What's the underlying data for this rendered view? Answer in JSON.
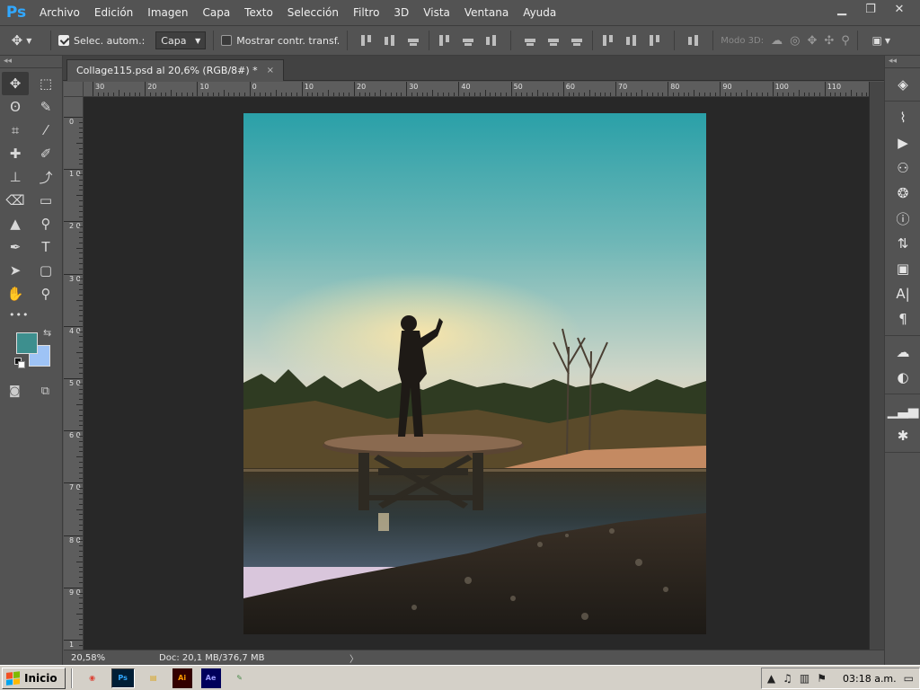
{
  "app": {
    "logo": "Ps",
    "menu": [
      "Archivo",
      "Edición",
      "Imagen",
      "Capa",
      "Texto",
      "Selección",
      "Filtro",
      "3D",
      "Vista",
      "Ventana",
      "Ayuda"
    ],
    "window_controls": {
      "minimize": "minimize-icon",
      "restore": "restore-icon",
      "close": "close-icon"
    }
  },
  "options_bar": {
    "auto_select_label": "Selec. autom.:",
    "auto_select_checked": true,
    "auto_select_target": "Capa",
    "show_transform_label": "Mostrar contr. transf.",
    "show_transform_checked": false,
    "mode_3d_label": "Modo 3D:"
  },
  "document": {
    "tab_title": "Collage115.psd al 20,6% (RGB/8#) *",
    "close_glyph": "×"
  },
  "rulers": {
    "horizontal": [
      "30",
      "20",
      "10",
      "0",
      "10",
      "20",
      "30",
      "40",
      "50",
      "60",
      "70",
      "80",
      "90",
      "100",
      "110"
    ],
    "vertical": [
      "0",
      "1 0",
      "2 0",
      "3 0",
      "4 0",
      "5 0",
      "6 0",
      "7 0",
      "8 0",
      "9 0",
      "1"
    ]
  },
  "toolbar": {
    "collapse": "◂◂",
    "tools": [
      {
        "name": "move-tool",
        "glyph": "✥",
        "active": true
      },
      {
        "name": "marquee-tool",
        "glyph": "⬚"
      },
      {
        "name": "lasso-tool",
        "glyph": "ʘ"
      },
      {
        "name": "quick-selection-tool",
        "glyph": "✎"
      },
      {
        "name": "crop-tool",
        "glyph": "⌗"
      },
      {
        "name": "eyedropper-tool",
        "glyph": "⁄"
      },
      {
        "name": "healing-brush-tool",
        "glyph": "✚"
      },
      {
        "name": "brush-tool",
        "glyph": "✐"
      },
      {
        "name": "clone-stamp-tool",
        "glyph": "⊥"
      },
      {
        "name": "history-brush-tool",
        "glyph": "⤴"
      },
      {
        "name": "eraser-tool",
        "glyph": "⌫"
      },
      {
        "name": "gradient-tool",
        "glyph": "▭"
      },
      {
        "name": "blur-tool",
        "glyph": "▲"
      },
      {
        "name": "dodge-tool",
        "glyph": "⚲"
      },
      {
        "name": "pen-tool",
        "glyph": "✒"
      },
      {
        "name": "type-tool",
        "glyph": "T"
      },
      {
        "name": "path-selection-tool",
        "glyph": "➤"
      },
      {
        "name": "shape-tool",
        "glyph": "▢"
      },
      {
        "name": "hand-tool",
        "glyph": "✋"
      },
      {
        "name": "zoom-tool",
        "glyph": "⚲"
      }
    ],
    "more_glyph": "•••",
    "foreground_color": "#3d8f8e",
    "background_color": "#9ec3f5",
    "swap_glyph": "⇆",
    "quick_mask_glyph": "◙",
    "screen_mode_glyph": "⧉"
  },
  "statusbar": {
    "zoom": "20,58%",
    "doc_info": "Doc: 20,1 MB/376,7 MB",
    "arrow": "〉"
  },
  "right_dock": {
    "collapse": "◂◂",
    "groups": [
      [
        {
          "name": "layers-panel-icon",
          "glyph": "◈"
        }
      ],
      [
        {
          "name": "paths-panel-icon",
          "glyph": "⌇"
        },
        {
          "name": "actions-panel-icon",
          "glyph": "▶"
        },
        {
          "name": "clone-source-panel-icon",
          "glyph": "⚇"
        },
        {
          "name": "color-panel-icon",
          "glyph": "❂"
        },
        {
          "name": "info-panel-icon",
          "glyph": "ⓘ"
        },
        {
          "name": "history-panel-icon",
          "glyph": "⇅"
        },
        {
          "name": "3d-panel-icon",
          "glyph": "▣"
        },
        {
          "name": "character-panel-icon",
          "glyph": "A|"
        },
        {
          "name": "paragraph-panel-icon",
          "glyph": "¶"
        }
      ],
      [
        {
          "name": "libraries-panel-icon",
          "glyph": "☁"
        },
        {
          "name": "adjustments-panel-icon",
          "glyph": "◐"
        }
      ],
      [
        {
          "name": "histogram-panel-icon",
          "glyph": "▁▃▅"
        },
        {
          "name": "navigator-panel-icon",
          "glyph": "✱"
        }
      ]
    ]
  },
  "taskbar": {
    "start_label": "Inicio",
    "apps": [
      {
        "name": "chrome-taskbar-icon",
        "glyph": "◉",
        "color": "#db4437"
      },
      {
        "name": "photoshop-taskbar-icon",
        "glyph": "Ps",
        "color": "#31a8ff",
        "active": true
      },
      {
        "name": "explorer-taskbar-icon",
        "glyph": "▤",
        "color": "#d9a520"
      },
      {
        "name": "illustrator-taskbar-icon",
        "glyph": "Ai",
        "color": "#ff9a00"
      },
      {
        "name": "after-effects-taskbar-icon",
        "glyph": "Ae",
        "color": "#9999ff"
      },
      {
        "name": "paint-taskbar-icon",
        "glyph": "✎",
        "color": "#4a8a4a"
      }
    ],
    "clock": "03:18 a.m."
  }
}
